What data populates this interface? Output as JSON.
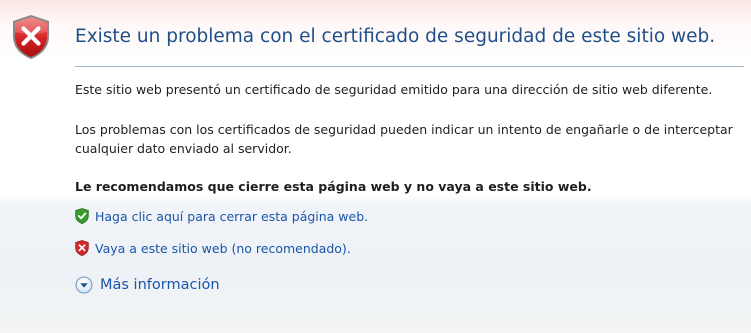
{
  "page": {
    "title": "Existe un problema con el certificado de seguridad de este sitio web.",
    "paragraph_1": "Este sitio web presentó un certificado de seguridad emitido para una dirección de sitio web diferente.",
    "paragraph_2": "Los problemas con los certificados de seguridad pueden indicar un intento de engañarle o de interceptar cualquier dato enviado al servidor.",
    "recommendation": "Le recomendamos que cierre esta página web y no vaya a este sitio web."
  },
  "actions": {
    "close_link": "Haga clic aquí para cerrar esta página web.",
    "continue_link": "Vaya a este sitio web (no recomendado).",
    "more_info": "Más información"
  },
  "icons": {
    "header": "red-shield-x-icon",
    "close": "green-shield-check-icon",
    "continue": "red-shield-x-icon",
    "more_info": "chevron-down-circle-icon"
  },
  "colors": {
    "title": "#1f4f88",
    "link": "#1a55a8",
    "error_red": "#d22a2a",
    "safe_green": "#3b9b2c"
  }
}
